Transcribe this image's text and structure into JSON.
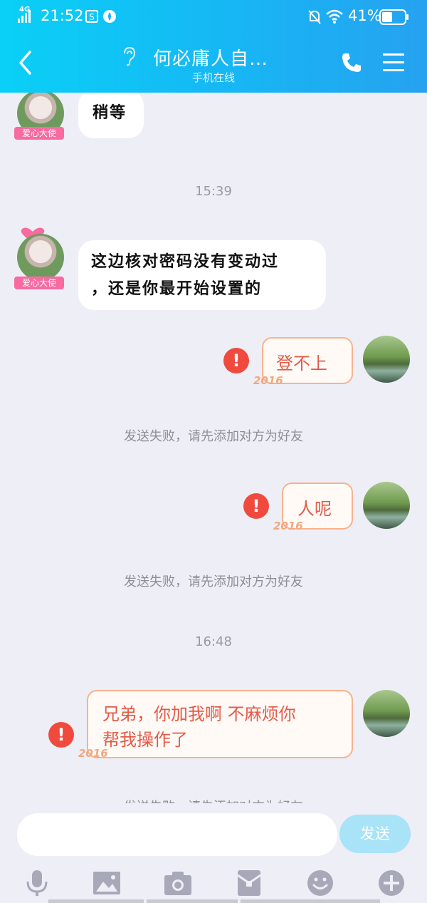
{
  "status_bar": {
    "network": "4G",
    "time": "21:52",
    "battery": "41%",
    "icons": [
      "signal-icon",
      "notify-s-icon",
      "notify-app-icon",
      "mute-icon",
      "wifi-icon",
      "battery-icon"
    ]
  },
  "header": {
    "title": "何必庸人自…",
    "subtitle": "手机在线",
    "icons": [
      "back-icon",
      "ear-icon",
      "phone-icon",
      "menu-icon"
    ]
  },
  "messages": {
    "m1": {
      "text": "稍等",
      "badge": "爱心大使"
    },
    "time1": "15:39",
    "m2": {
      "line1": "这边核对密码没有变动过",
      "line2": "，还是你最开始设置的",
      "badge": "爱心大使"
    },
    "m3": {
      "text": "登不上",
      "deco": "2016"
    },
    "fail1": "发送失败，请先添加对方为好友",
    "m4": {
      "text": "人呢",
      "deco": "2016"
    },
    "fail2": "发送失败，请先添加对方为好友",
    "time2": "16:48",
    "m5": {
      "line1": "兄弟，你加我啊 不麻烦你",
      "line2": "帮我操作了",
      "deco": "2016"
    },
    "fail3": "发送失败，请先添加对方为好友"
  },
  "input_bar": {
    "send_label": "发送",
    "placeholder": ""
  },
  "toolbar": [
    "mic-icon",
    "image-icon",
    "camera-icon",
    "red-packet-icon",
    "emoji-icon",
    "plus-icon"
  ]
}
